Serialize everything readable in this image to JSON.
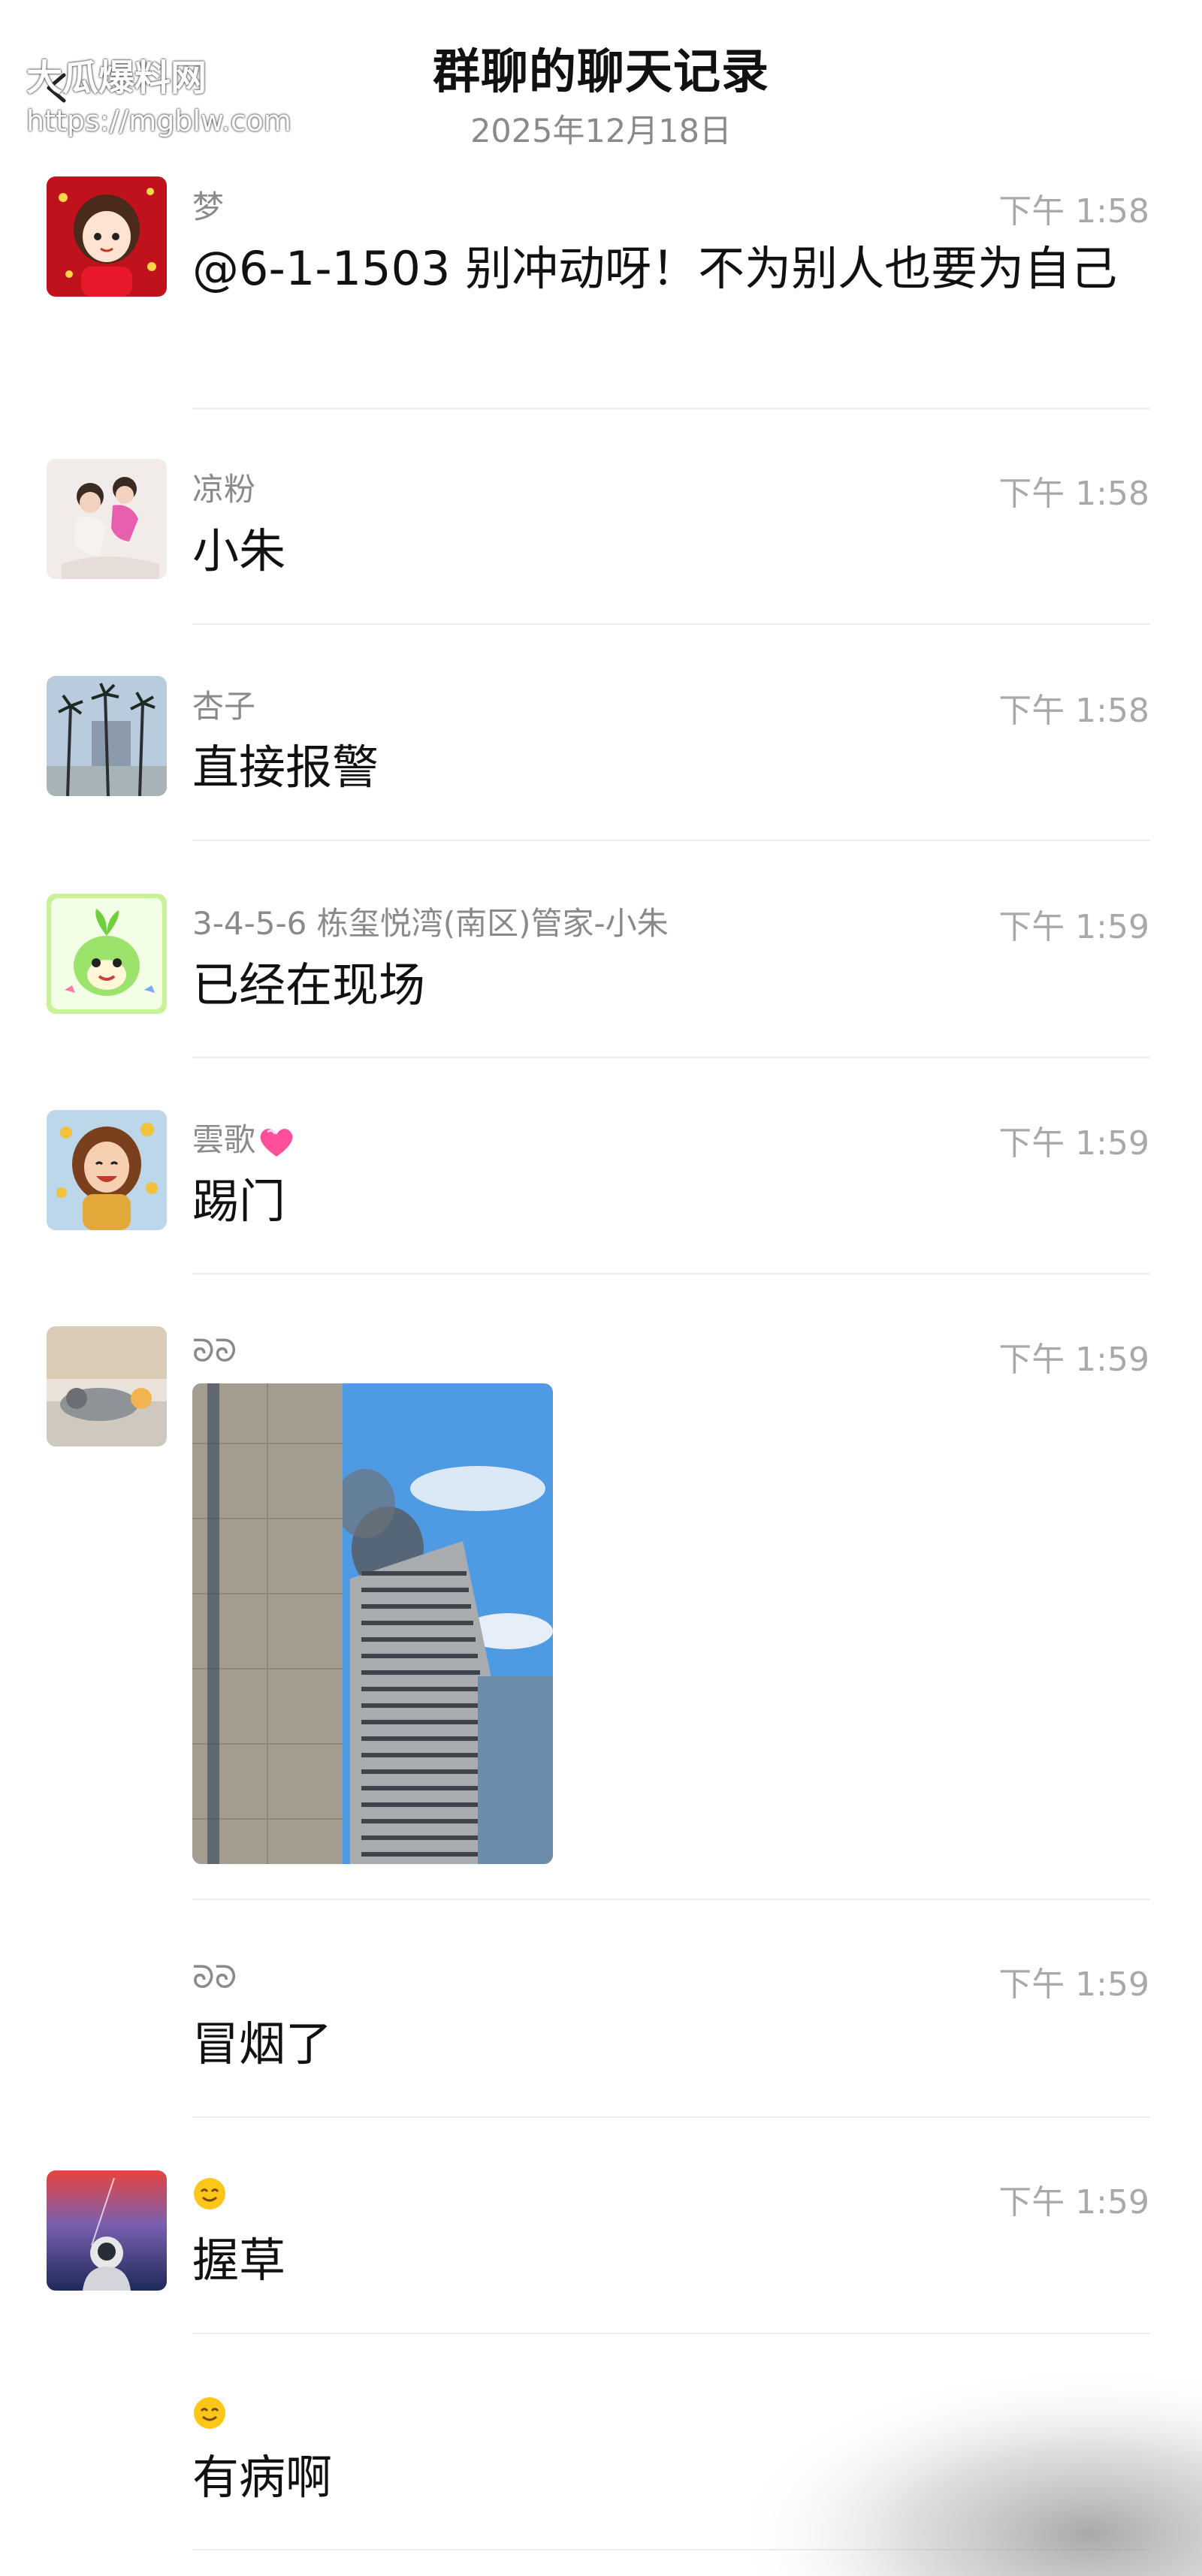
{
  "header": {
    "title": "群聊的聊天记录",
    "date": "2025年12月18日",
    "back_icon": "chevron-left-icon"
  },
  "watermark": {
    "name": "大瓜爆料网",
    "url": "https://mgblw.com"
  },
  "messages": [
    {
      "sender": "梦",
      "time": "下午 1:58",
      "text": "@6-1-1503 别冲动呀！不为别人也要为自己"
    },
    {
      "sender": "凉粉",
      "time": "下午 1:58",
      "text": "小朱"
    },
    {
      "sender": "杏子",
      "time": "下午 1:58",
      "text": "直接报警"
    },
    {
      "sender": "3-4-5-6 栋玺悦湾(南区)管家-小朱",
      "time": "下午 1:59",
      "text": "已经在现场"
    },
    {
      "sender": "雲歌",
      "sender_icon": "pink-heart-icon",
      "time": "下午 1:59",
      "text": "踢门"
    },
    {
      "sender": "ᘐᘐ",
      "time": "下午 1:59",
      "image": "photo-of-smoking-apartment-building"
    },
    {
      "sender": "ᘐᘐ",
      "time": "下午 1:59",
      "text": "冒烟了"
    },
    {
      "sender_icon": "smiling-face-emoji",
      "time": "下午 1:59",
      "text": "握草"
    },
    {
      "sender_icon": "smiling-face-emoji",
      "time": "",
      "text": "有病啊"
    }
  ],
  "colors": {
    "meta_gray": "#8a8a8a",
    "time_gray": "#a9a9a9",
    "divider": "#ececec",
    "heart_pink": "#ff4f9a",
    "emoji_yellow": "#ffc61a"
  }
}
